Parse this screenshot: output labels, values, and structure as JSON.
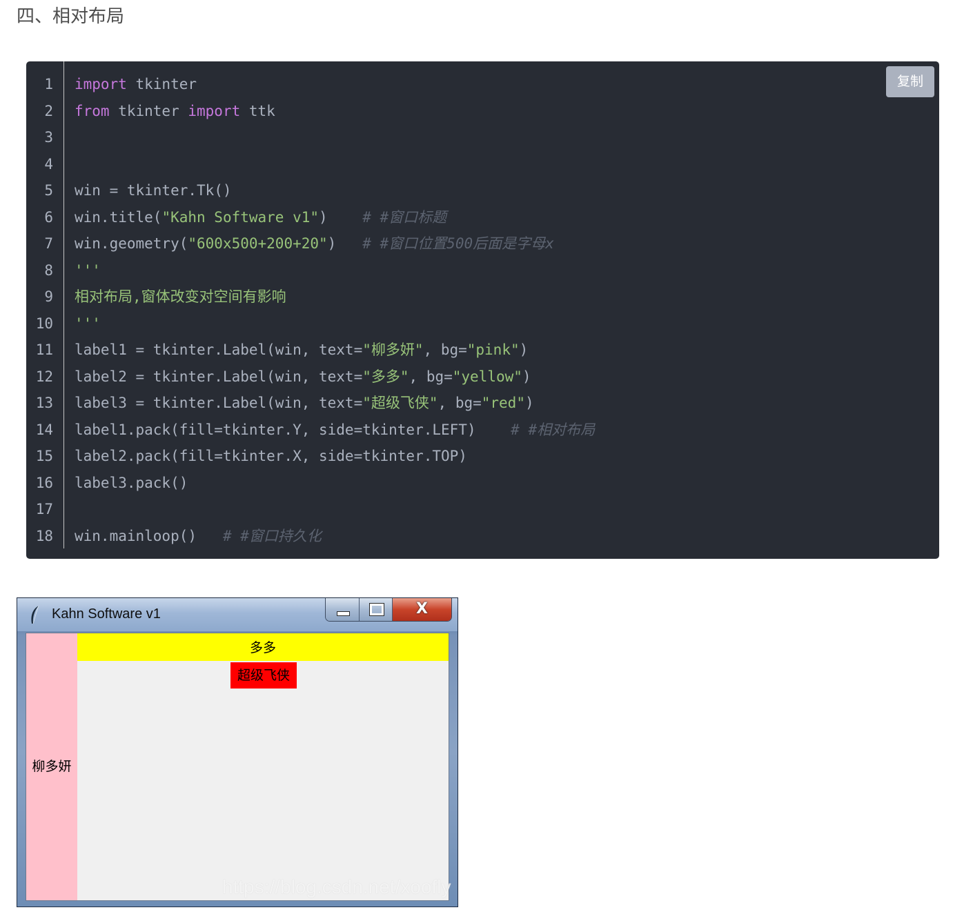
{
  "heading": "四、相对布局",
  "code": {
    "copy_label": "复制",
    "line_numbers": [
      "1",
      "2",
      "3",
      "4",
      "5",
      "6",
      "7",
      "8",
      "9",
      "10",
      "11",
      "12",
      "13",
      "14",
      "15",
      "16",
      "17",
      "18"
    ],
    "lines": [
      [
        {
          "t": "import",
          "c": "kw"
        },
        {
          "t": " tkinter",
          "c": ""
        }
      ],
      [
        {
          "t": "from",
          "c": "kw"
        },
        {
          "t": " tkinter ",
          "c": ""
        },
        {
          "t": "import",
          "c": "kw"
        },
        {
          "t": " ttk",
          "c": ""
        }
      ],
      [],
      [],
      [
        {
          "t": "win = tkinter.Tk()",
          "c": ""
        }
      ],
      [
        {
          "t": "win.title(",
          "c": ""
        },
        {
          "t": "\"Kahn Software v1\"",
          "c": "str"
        },
        {
          "t": ")    ",
          "c": ""
        },
        {
          "t": "# #窗口标题",
          "c": "cm"
        }
      ],
      [
        {
          "t": "win.geometry(",
          "c": ""
        },
        {
          "t": "\"600x500+200+20\"",
          "c": "str"
        },
        {
          "t": ")   ",
          "c": ""
        },
        {
          "t": "# #窗口位置500后面是字母x",
          "c": "cm"
        }
      ],
      [
        {
          "t": "'''",
          "c": "str"
        }
      ],
      [
        {
          "t": "相对布局,窗体改变对空间有影响",
          "c": "str"
        }
      ],
      [
        {
          "t": "'''",
          "c": "str"
        }
      ],
      [
        {
          "t": "label1 = tkinter.Label(win, text=",
          "c": ""
        },
        {
          "t": "\"柳多妍\"",
          "c": "str"
        },
        {
          "t": ", bg=",
          "c": ""
        },
        {
          "t": "\"pink\"",
          "c": "str"
        },
        {
          "t": ")",
          "c": ""
        }
      ],
      [
        {
          "t": "label2 = tkinter.Label(win, text=",
          "c": ""
        },
        {
          "t": "\"多多\"",
          "c": "str"
        },
        {
          "t": ", bg=",
          "c": ""
        },
        {
          "t": "\"yellow\"",
          "c": "str"
        },
        {
          "t": ")",
          "c": ""
        }
      ],
      [
        {
          "t": "label3 = tkinter.Label(win, text=",
          "c": ""
        },
        {
          "t": "\"超级飞侠\"",
          "c": "str"
        },
        {
          "t": ", bg=",
          "c": ""
        },
        {
          "t": "\"red\"",
          "c": "str"
        },
        {
          "t": ")",
          "c": ""
        }
      ],
      [
        {
          "t": "label1.pack(fill=tkinter.Y, side=tkinter.LEFT)    ",
          "c": ""
        },
        {
          "t": "# #相对布局",
          "c": "cm"
        }
      ],
      [
        {
          "t": "label2.pack(fill=tkinter.X, side=tkinter.TOP)",
          "c": ""
        }
      ],
      [
        {
          "t": "label3.pack()",
          "c": ""
        }
      ],
      [],
      [
        {
          "t": "win.mainloop()   ",
          "c": ""
        },
        {
          "t": "# #窗口持久化",
          "c": "cm"
        }
      ]
    ]
  },
  "screenshot": {
    "window_title": "Kahn Software v1",
    "close_glyph": "X",
    "label1_text": "柳多妍",
    "label2_text": "多多",
    "label3_text": "超级飞侠",
    "watermark": "https://blog.csdn.net/xoofly",
    "colors": {
      "label1_bg": "#ffc0cb",
      "label2_bg": "#ffff00",
      "label3_bg": "#ff0000"
    }
  }
}
